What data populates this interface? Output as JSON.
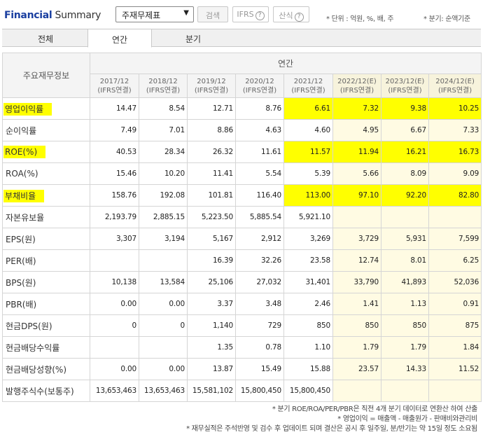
{
  "header": {
    "title_a": "Financial",
    "title_b": " Summary",
    "select_value": "주재무제표",
    "search_label": "검색",
    "ifrs_label": "IFRS",
    "formula_label": "산식",
    "unit_note": "* 단위 : 억원, %, 배, 주",
    "quarter_note": "* 분기: 순액기준",
    "help_icon": "?"
  },
  "tabs": [
    {
      "label": "전체",
      "active": false
    },
    {
      "label": "연간",
      "active": true
    },
    {
      "label": "분기",
      "active": false
    }
  ],
  "table": {
    "corner_label": "주요재무정보",
    "group_label": "연간",
    "years": [
      {
        "year": "2017/12",
        "basis": "(IFRS연결)"
      },
      {
        "year": "2018/12",
        "basis": "(IFRS연결)"
      },
      {
        "year": "2019/12",
        "basis": "(IFRS연결)"
      },
      {
        "year": "2020/12",
        "basis": "(IFRS연결)"
      },
      {
        "year": "2021/12",
        "basis": "(IFRS연결)"
      },
      {
        "year": "2022/12(E)",
        "basis": "(IFRS연결)"
      },
      {
        "year": "2023/12(E)",
        "basis": "(IFRS연결)"
      },
      {
        "year": "2024/12(E)",
        "basis": "(IFRS연결)"
      }
    ],
    "rows": [
      {
        "label": "영업이익률",
        "values": [
          "14.47",
          "8.54",
          "12.71",
          "8.76",
          "6.61",
          "7.32",
          "9.38",
          "10.25"
        ]
      },
      {
        "label": "순이익률",
        "values": [
          "7.49",
          "7.01",
          "8.86",
          "4.63",
          "4.60",
          "4.95",
          "6.67",
          "7.33"
        ]
      },
      {
        "label": "ROE(%)",
        "values": [
          "40.53",
          "28.34",
          "26.32",
          "11.61",
          "11.57",
          "11.94",
          "16.21",
          "16.73"
        ]
      },
      {
        "label": "ROA(%)",
        "values": [
          "15.46",
          "10.20",
          "11.41",
          "5.54",
          "5.39",
          "5.66",
          "8.09",
          "9.09"
        ]
      },
      {
        "label": "부채비율",
        "values": [
          "158.76",
          "192.08",
          "101.81",
          "116.40",
          "113.00",
          "97.10",
          "92.20",
          "82.80"
        ]
      },
      {
        "label": "자본유보율",
        "values": [
          "2,193.79",
          "2,885.15",
          "5,223.50",
          "5,885.54",
          "5,921.10",
          "",
          "",
          ""
        ]
      },
      {
        "label": "EPS(원)",
        "values": [
          "3,307",
          "3,194",
          "5,167",
          "2,912",
          "3,269",
          "3,729",
          "5,931",
          "7,599"
        ]
      },
      {
        "label": "PER(배)",
        "values": [
          "",
          "",
          "16.39",
          "32.26",
          "23.58",
          "12.74",
          "8.01",
          "6.25"
        ]
      },
      {
        "label": "BPS(원)",
        "values": [
          "10,138",
          "13,584",
          "25,106",
          "27,032",
          "31,401",
          "33,790",
          "41,893",
          "52,036"
        ]
      },
      {
        "label": "PBR(배)",
        "values": [
          "0.00",
          "0.00",
          "3.37",
          "3.48",
          "2.46",
          "1.41",
          "1.13",
          "0.91"
        ]
      },
      {
        "label": "현금DPS(원)",
        "values": [
          "0",
          "0",
          "1,140",
          "729",
          "850",
          "850",
          "850",
          "875"
        ]
      },
      {
        "label": "현금배당수익률",
        "values": [
          "",
          "",
          "1.35",
          "0.78",
          "1.10",
          "1.79",
          "1.79",
          "1.84"
        ]
      },
      {
        "label": "현금배당성향(%)",
        "values": [
          "0.00",
          "0.00",
          "13.87",
          "15.49",
          "15.88",
          "23.57",
          "14.33",
          "11.52"
        ]
      },
      {
        "label": "발행주식수(보통주)",
        "values": [
          "13,653,463",
          "13,653,463",
          "15,581,102",
          "15,800,450",
          "15,800,450",
          "",
          "",
          ""
        ]
      }
    ]
  },
  "footnotes": [
    "* 분기 ROE/ROA/PER/PBR은 직전 4개 분기 데이터로 연환산 하여 산출",
    "* 영업이익 = 매출액 - 매출원가 - 판매비와관리비",
    "* 재무실적은 주석반영 및 검수 후 업데이트 되며 결산은 공시 후 일주일, 분/반기는 약 15일 정도 소요됨"
  ],
  "colors": {
    "highlight": "#ffff00",
    "estimate_bg": "#fffbe3",
    "title_blue": "#1a3fa0"
  }
}
